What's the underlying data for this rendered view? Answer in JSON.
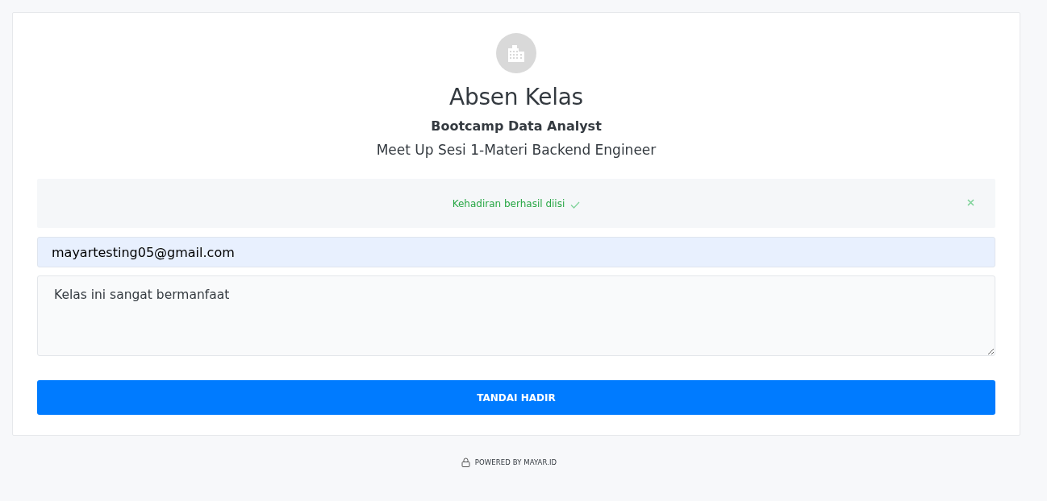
{
  "header": {
    "title": "Absen Kelas",
    "subtitle": "Bootcamp Data Analyst",
    "session": "Meet Up Sesi 1-Materi Backend Engineer"
  },
  "alert": {
    "kind": "success",
    "message": "Kehadiran berhasil diisi",
    "dismissible": true
  },
  "form": {
    "email": {
      "value": "mayartesting05@gmail.com"
    },
    "note": {
      "value": "Kelas ini sangat bermanfaat"
    },
    "submit": "TANDAI HADIR"
  },
  "footer": {
    "text": "POWERED BY MAYAR.ID"
  }
}
